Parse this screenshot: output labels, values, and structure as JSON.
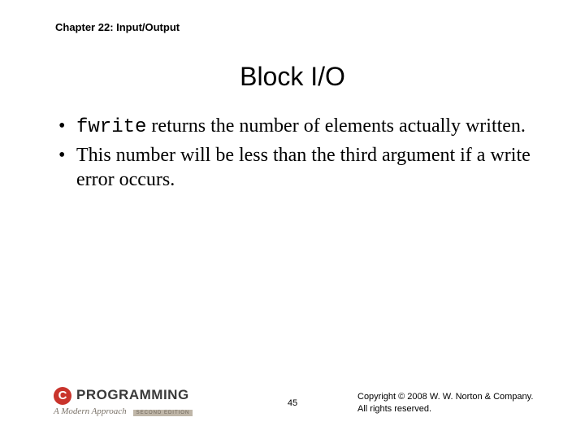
{
  "chapter": "Chapter 22: Input/Output",
  "title": "Block I/O",
  "bullets": [
    {
      "code": "fwrite",
      "rest": " returns the number of elements actually written."
    },
    {
      "text": "This number will be less than the third argument if a write error occurs."
    }
  ],
  "footer": {
    "logo": {
      "mark": "C",
      "word": "PROGRAMMING",
      "subtitle": "A Modern Approach",
      "edition": "SECOND EDITION"
    },
    "page": "45",
    "copyright_line1": "Copyright © 2008 W. W. Norton & Company.",
    "copyright_line2": "All rights reserved."
  }
}
